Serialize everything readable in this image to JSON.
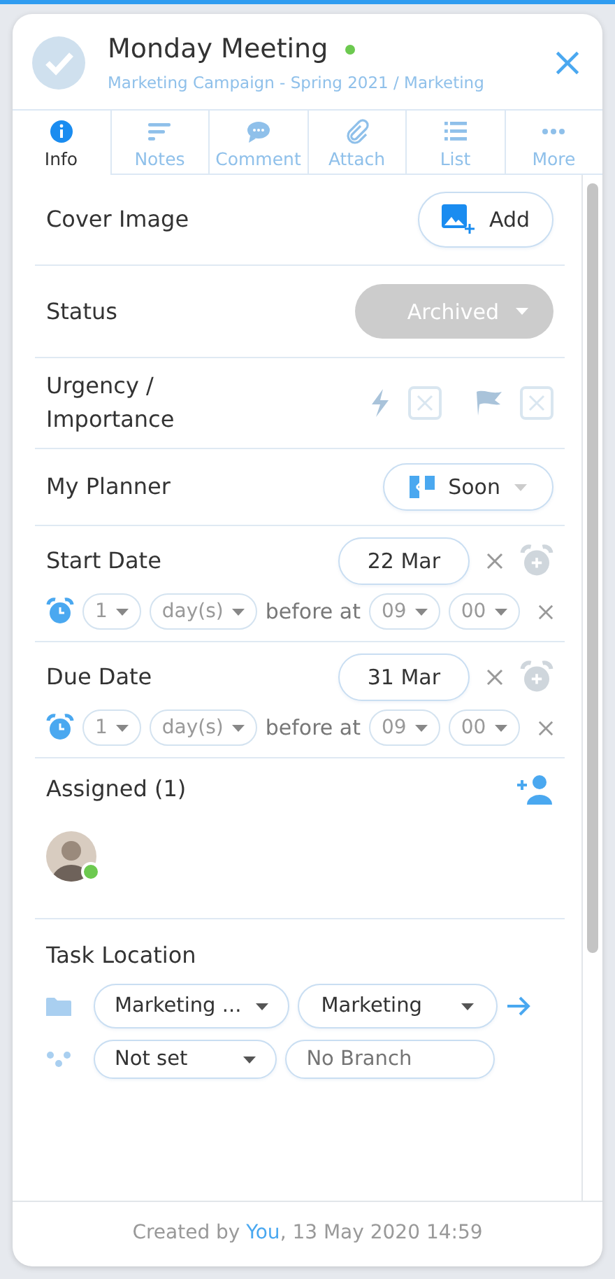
{
  "header": {
    "title": "Monday Meeting",
    "live": true,
    "done": false,
    "breadcrumb": "Marketing Campaign - Spring 2021 / Marketing"
  },
  "tabs": [
    {
      "label": "Info",
      "selected": true
    },
    {
      "label": "Notes",
      "selected": false
    },
    {
      "label": "Comment",
      "selected": false
    },
    {
      "label": "Attach",
      "selected": false
    },
    {
      "label": "List",
      "selected": false
    },
    {
      "label": "More",
      "selected": false
    }
  ],
  "cover_image": {
    "label": "Cover Image",
    "button": "Add"
  },
  "status": {
    "label": "Status",
    "value": "Archived"
  },
  "urgency": {
    "label": "Urgency / Importance",
    "urgent": false,
    "important": false
  },
  "planner": {
    "label": "My Planner",
    "value": "Soon"
  },
  "dates": [
    {
      "label": "Start Date",
      "value": "22 Mar",
      "reminder": {
        "amount": "1",
        "unit": "day(s)",
        "text": "before at",
        "hour": "09",
        "minute": "00"
      }
    },
    {
      "label": "Due Date",
      "value": "31 Mar",
      "reminder": {
        "amount": "1",
        "unit": "day(s)",
        "text": "before at",
        "hour": "09",
        "minute": "00"
      }
    }
  ],
  "assigned": {
    "label": "Assigned (1)",
    "people": [
      {
        "online": true
      }
    ]
  },
  "task_location": {
    "label": "Task Location",
    "project": "Marketing ...",
    "list": "Marketing",
    "workflow": "Not set",
    "branch_placeholder": "No Branch"
  },
  "footer": {
    "prefix": "Created by",
    "author": "You",
    "date": ", 13 May 2020 14:59"
  }
}
